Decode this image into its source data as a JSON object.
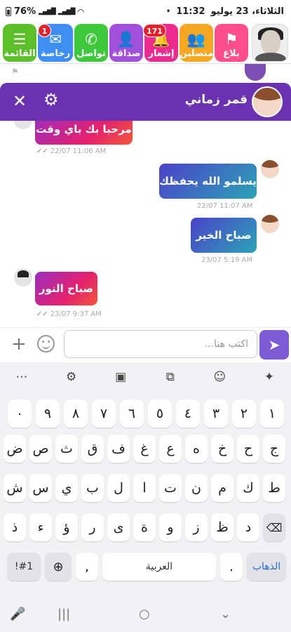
{
  "status_bar": {
    "battery": "76%",
    "date": "الثلاثاء، 23 يوليو",
    "time": "11:32"
  },
  "top_nav": {
    "report": "بلاغ",
    "online": "متصلين",
    "notifications": "إشعار",
    "notifications_count": "171",
    "friendship": "صداقة",
    "contact": "تواصل",
    "private": "رخاصة",
    "private_count": "1",
    "menu": "القائمة",
    "colors": {
      "report": "#ff4e8a",
      "online": "#f6a623",
      "notifications": "#ec2b90",
      "friendship": "#a24fdc",
      "contact": "#3ec83b",
      "private": "#3d8df3",
      "menu": "#5bbf2a"
    }
  },
  "chat_header": {
    "title": "قمر زماني"
  },
  "messages": [
    {
      "text": "مرحبا بك باي وقت",
      "time": "22/07 11:06 AM"
    },
    {
      "text": "يسلمو الله يحفظك",
      "time": "22/07 11:07 AM"
    },
    {
      "text": "صباح الخير",
      "time": "23/07 5:19 AM"
    },
    {
      "text": "صباح النور",
      "time": "23/07 9:37 AM"
    }
  ],
  "composer": {
    "placeholder": "اكتب هنا..."
  },
  "keyboard": {
    "row_numbers": [
      "١",
      "٢",
      "٣",
      "٤",
      "٥",
      "٦",
      "٧",
      "٨",
      "٩",
      "٠"
    ],
    "row1": [
      "ج",
      "ح",
      "خ",
      "ه",
      "ع",
      "غ",
      "ف",
      "ق",
      "ث",
      "ص",
      "ض"
    ],
    "row2": [
      "ط",
      "ك",
      "م",
      "ن",
      "ت",
      "ا",
      "ل",
      "ب",
      "ي",
      "س",
      "ش"
    ],
    "row3": [
      "د",
      "ظ",
      "ز",
      "و",
      "ة",
      "ى",
      "ر",
      "ؤ",
      "ء",
      "ذ"
    ],
    "symbols_key": "!#1",
    "space_label": "العربية",
    "go_key": "الذهاب",
    "comma_key": ",",
    "period_key": "."
  }
}
